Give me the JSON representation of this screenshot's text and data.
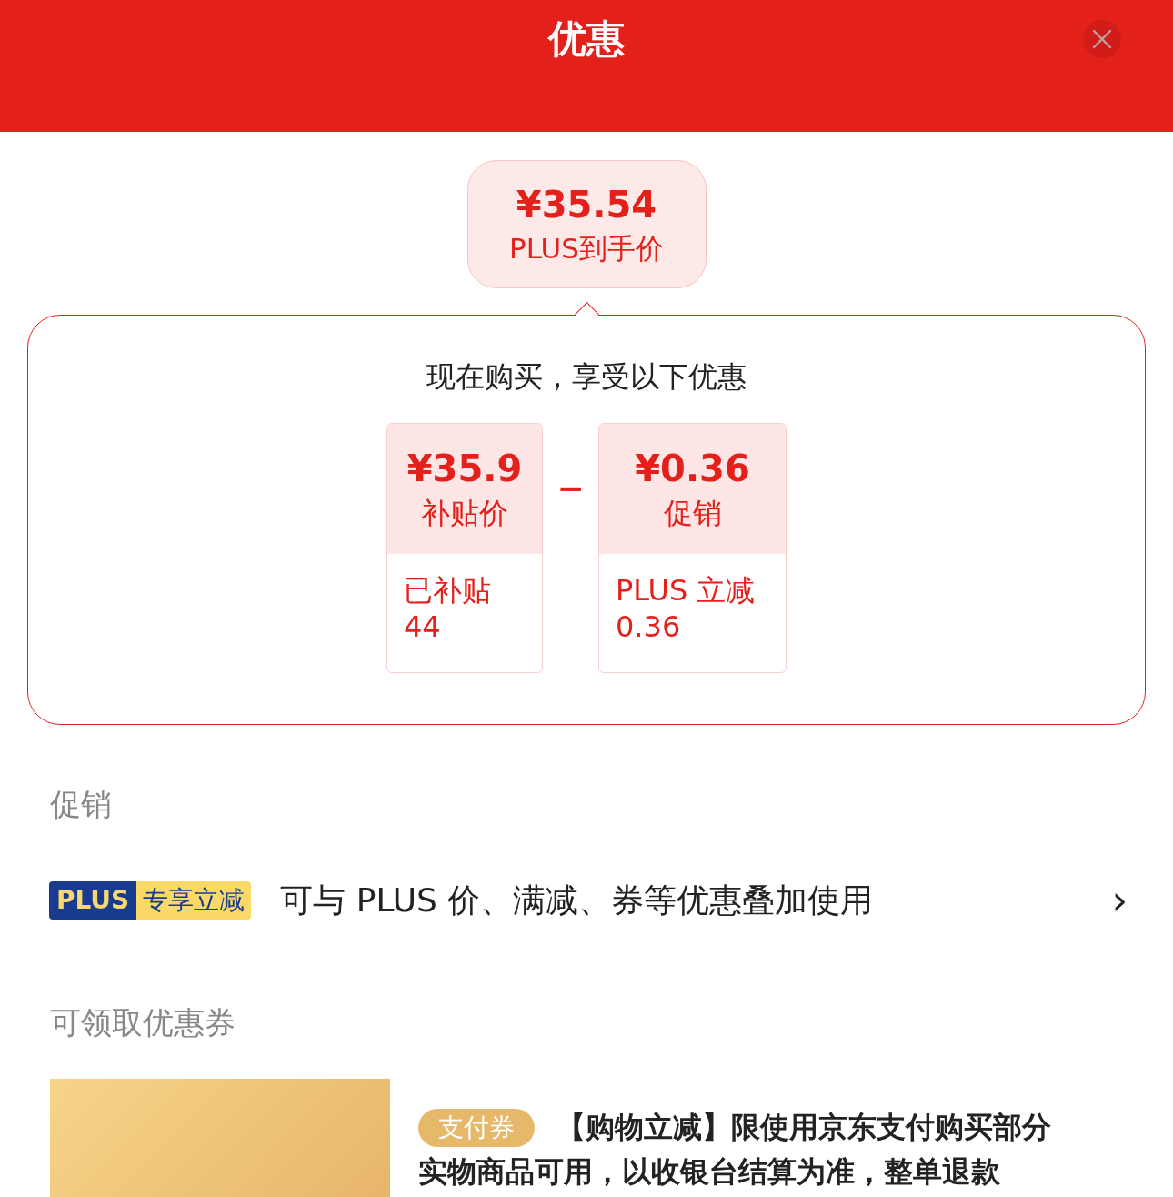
{
  "header": {
    "title": "优惠"
  },
  "price_bubble": {
    "price": "¥35.54",
    "label": "PLUS到手价"
  },
  "breakdown": {
    "heading": "现在购买，享受以下优惠",
    "operator": "−",
    "items": [
      {
        "amount": "¥35.9",
        "label": "补贴价",
        "detail_lines": [
          "已补贴",
          "44"
        ]
      },
      {
        "amount": "¥0.36",
        "label": "促销",
        "detail_lines": [
          "PLUS 立减",
          "0.36"
        ]
      }
    ]
  },
  "promotions": {
    "heading": "促销",
    "items": [
      {
        "badge_left": "PLUS",
        "badge_right": "专享立减",
        "text": "可与 PLUS 价、满减、券等优惠叠加使用",
        "chevron": "›"
      }
    ]
  },
  "coupons": {
    "heading": "可领取优惠券",
    "items": [
      {
        "tag": "支付券",
        "lines": [
          "【购物立减】限使用京东支付购买部分",
          "实物商品可用，以收银台结算为准，整单退款"
        ]
      }
    ]
  }
}
